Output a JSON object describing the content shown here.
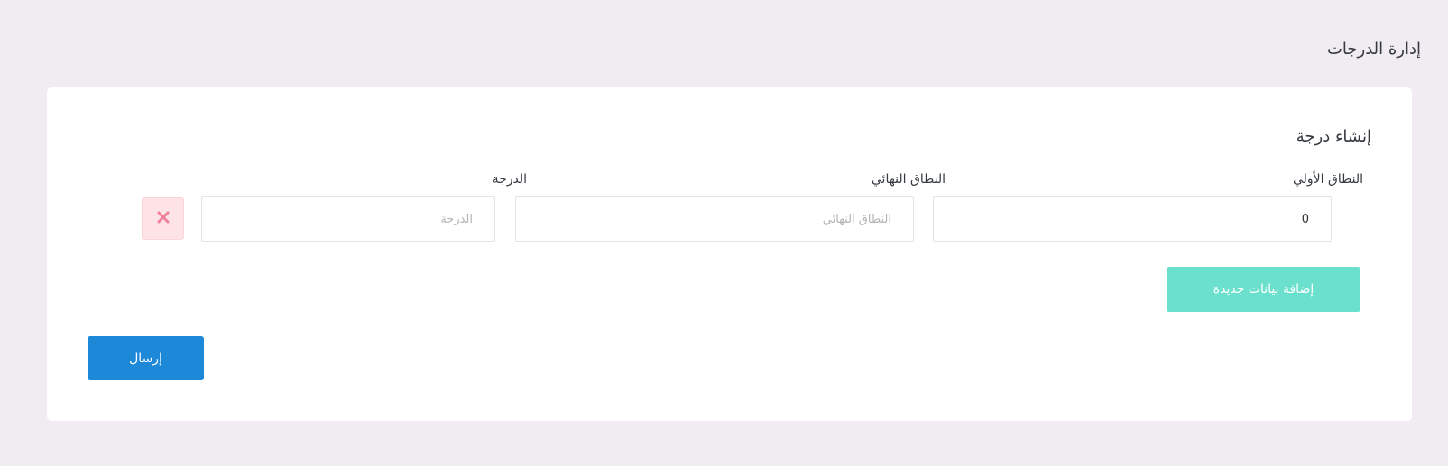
{
  "header": {
    "title": "إدارة الدرجات"
  },
  "form": {
    "title": "إنشاء درجة",
    "fields": {
      "start_range": {
        "label": "النطاق الأولي",
        "value": "0",
        "placeholder": ""
      },
      "end_range": {
        "label": "النطاق النهائي",
        "value": "",
        "placeholder": "النطاق النهائي"
      },
      "grade": {
        "label": "الدرجة",
        "value": "",
        "placeholder": "الدرجة"
      }
    },
    "remove_icon": "close-icon",
    "add_button_label": "إضافة بيانات جديدة",
    "submit_button_label": "إرسال"
  },
  "colors": {
    "background": "#f1ecf2",
    "card": "#ffffff",
    "add_button": "#6ae0cd",
    "submit_button": "#1e88d8",
    "remove_button_bg": "#fde2e6",
    "remove_icon": "#f17f97"
  }
}
